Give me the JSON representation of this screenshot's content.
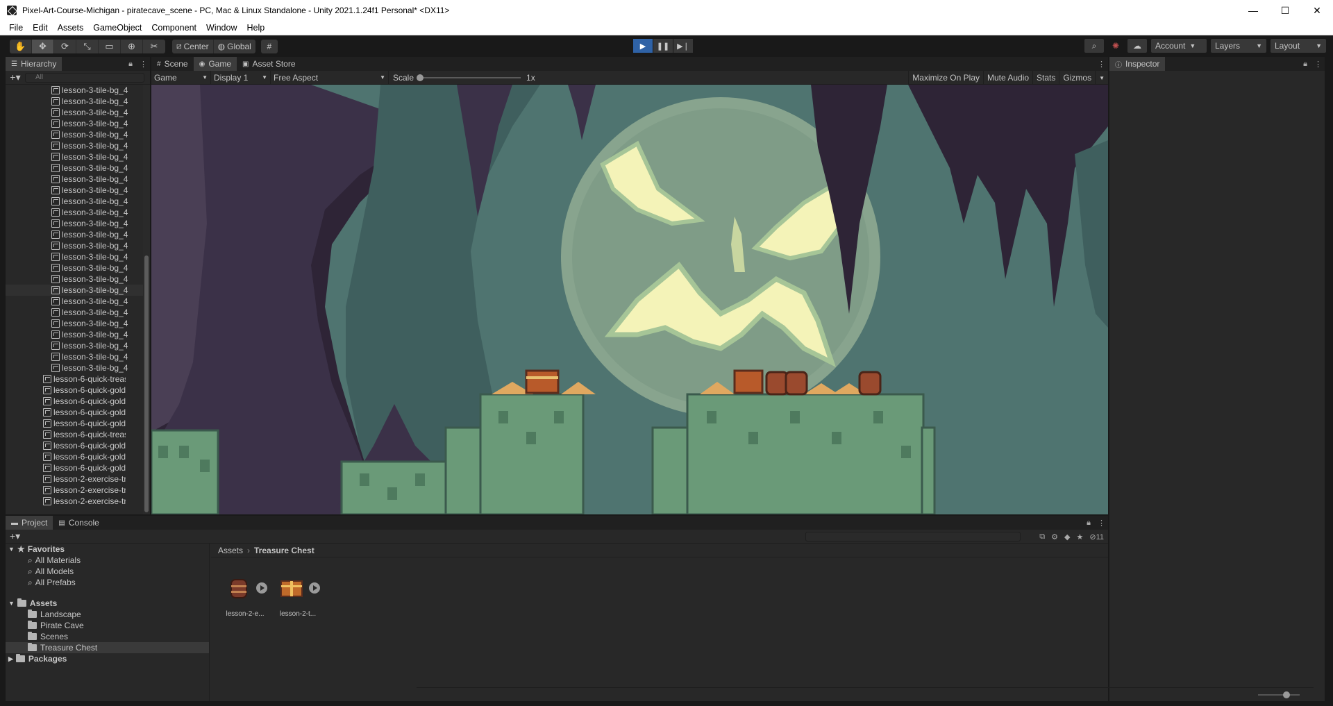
{
  "window": {
    "title": "Pixel-Art-Course-Michigan - piratecave_scene - PC, Mac & Linux Standalone - Unity 2021.1.24f1 Personal* <DX11>",
    "minimize": "—",
    "maximize": "☐",
    "close": "✕"
  },
  "menu": [
    "File",
    "Edit",
    "Assets",
    "GameObject",
    "Component",
    "Window",
    "Help"
  ],
  "toolbar": {
    "pivot": "Center",
    "space": "Global",
    "account": "Account",
    "layers": "Layers",
    "layout": "Layout"
  },
  "hierarchy": {
    "tab": "Hierarchy",
    "search_placeholder": "All",
    "items": [
      "lesson-3-tile-bg_4",
      "lesson-3-tile-bg_4",
      "lesson-3-tile-bg_4",
      "lesson-3-tile-bg_4",
      "lesson-3-tile-bg_4",
      "lesson-3-tile-bg_4",
      "lesson-3-tile-bg_4",
      "lesson-3-tile-bg_4",
      "lesson-3-tile-bg_4",
      "lesson-3-tile-bg_4",
      "lesson-3-tile-bg_4",
      "lesson-3-tile-bg_4",
      "lesson-3-tile-bg_4",
      "lesson-3-tile-bg_4",
      "lesson-3-tile-bg_4",
      "lesson-3-tile-bg_4",
      "lesson-3-tile-bg_4",
      "lesson-3-tile-bg_4",
      "lesson-3-tile-bg_4",
      "lesson-3-tile-bg_4",
      "lesson-3-tile-bg_4",
      "lesson-3-tile-bg_4",
      "lesson-3-tile-bg_4",
      "lesson-3-tile-bg_4",
      "lesson-3-tile-bg_4",
      "lesson-3-tile-bg_4",
      "lesson-6-quick-treas",
      "lesson-6-quick-gold",
      "lesson-6-quick-gold",
      "lesson-6-quick-gold",
      "lesson-6-quick-gold",
      "lesson-6-quick-treas",
      "lesson-6-quick-gold",
      "lesson-6-quick-gold",
      "lesson-6-quick-gold",
      "lesson-2-exercise-tr",
      "lesson-2-exercise-tr",
      "lesson-2-exercise-tr"
    ]
  },
  "tabs": {
    "scene": "Scene",
    "game": "Game",
    "asset_store": "Asset Store"
  },
  "game_toolbar": {
    "mode": "Game",
    "display": "Display 1",
    "aspect": "Free Aspect",
    "scale_label": "Scale",
    "scale_value": "1x",
    "maximize": "Maximize On Play",
    "mute": "Mute Audio",
    "stats": "Stats",
    "gizmos": "Gizmos"
  },
  "inspector": {
    "tab": "Inspector"
  },
  "project": {
    "tab_project": "Project",
    "tab_console": "Console",
    "hidden_count": "11",
    "favorites": "Favorites",
    "favorite_items": [
      "All Materials",
      "All Models",
      "All Prefabs"
    ],
    "assets": "Assets",
    "folders": [
      "Landscape",
      "Pirate Cave",
      "Scenes",
      "Treasure Chest"
    ],
    "selected_folder": "Treasure Chest",
    "packages": "Packages",
    "breadcrumb_root": "Assets",
    "breadcrumb_current": "Treasure Chest",
    "asset_items": [
      "lesson-2-e...",
      "lesson-2-t..."
    ]
  },
  "colors": {
    "play_active": "#2f62a6",
    "panel_bg": "#282828",
    "cave_dark": "#2e2436",
    "cave_teal": "#4f7470",
    "moon": "#88a48e",
    "face": "#f4f3b8",
    "grass": "#6a9a78"
  }
}
